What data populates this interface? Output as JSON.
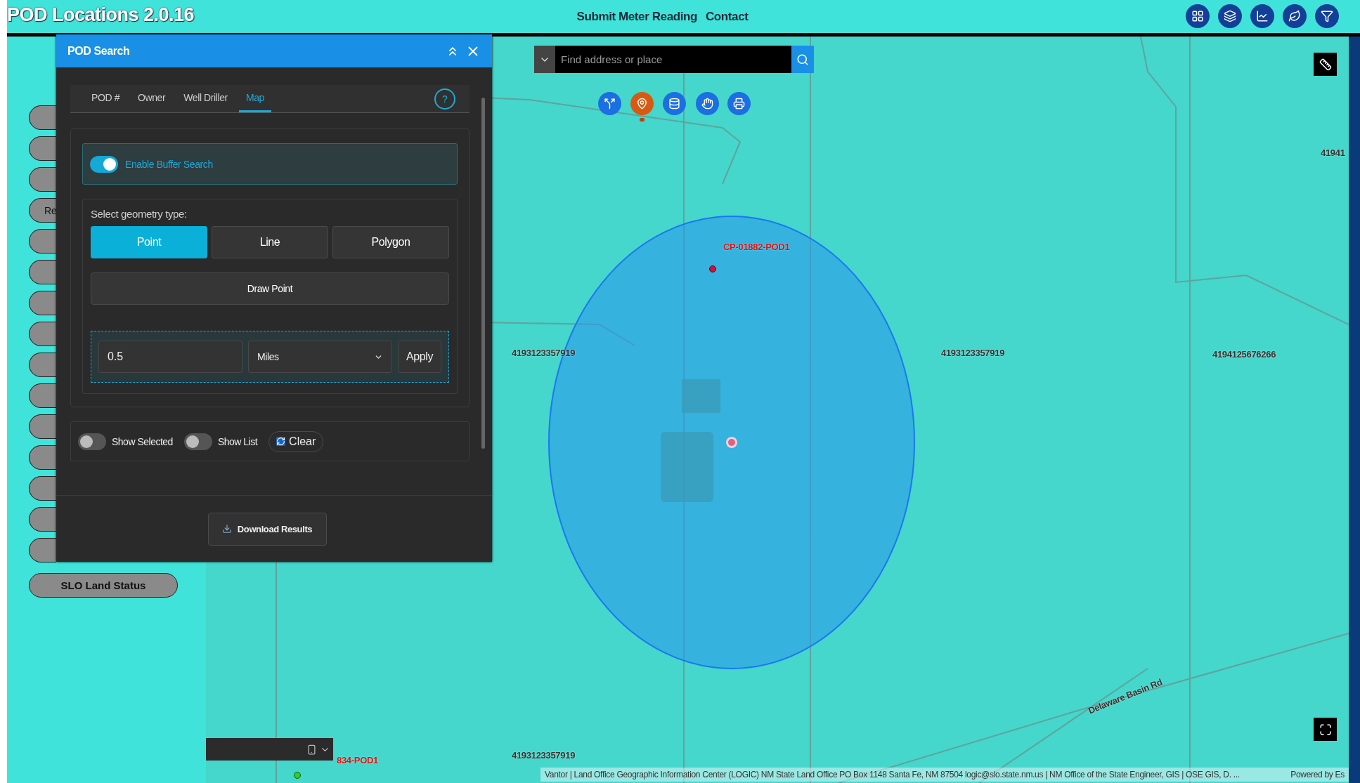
{
  "app": {
    "title": "POD Locations 2.0.16",
    "nav_links": [
      "Submit Meter Reading",
      "Contact"
    ]
  },
  "sidebar": {
    "pills": [
      {
        "kind": "blank"
      },
      {
        "kind": "blank"
      },
      {
        "kind": "blank"
      },
      {
        "kind": "text",
        "label": "Re"
      },
      {
        "kind": "blank"
      },
      {
        "kind": "blank"
      },
      {
        "kind": "blank"
      },
      {
        "kind": "blank"
      },
      {
        "kind": "blank"
      },
      {
        "kind": "blank"
      },
      {
        "kind": "blank"
      },
      {
        "kind": "blank"
      },
      {
        "kind": "blank"
      },
      {
        "kind": "blank"
      },
      {
        "kind": "blank"
      },
      {
        "kind": "text",
        "label": "SLO Land Status"
      }
    ]
  },
  "panel": {
    "title": "POD Search",
    "tabs": [
      {
        "label": "POD #",
        "selected": false
      },
      {
        "label": "Owner",
        "selected": false
      },
      {
        "label": "Well Driller",
        "selected": false
      },
      {
        "label": "Map",
        "selected": true
      }
    ],
    "help": "?",
    "buffer": {
      "label": "Enable Buffer Search",
      "on": true
    },
    "geometry": {
      "label": "Select geometry type:",
      "types": [
        {
          "label": "Point",
          "selected": true
        },
        {
          "label": "Line",
          "selected": false
        },
        {
          "label": "Polygon",
          "selected": false
        }
      ],
      "draw_button": "Draw Point"
    },
    "distance": {
      "value": "0.5",
      "unit": "Miles",
      "apply": "Apply"
    },
    "toggles": [
      {
        "label": "Show Selected",
        "on": false
      },
      {
        "label": "Show List",
        "on": false
      }
    ],
    "clear_button": "Clear",
    "download_button": "Download Results"
  },
  "map": {
    "search": {
      "placeholder": "Find address or place"
    },
    "tools": [
      {
        "selected": false
      },
      {
        "selected": true
      },
      {
        "selected": false
      },
      {
        "selected": false
      },
      {
        "selected": false
      }
    ],
    "labels": [
      {
        "kind": "pod",
        "text": "CP-01882-POD1"
      },
      {
        "kind": "parcel",
        "text": "4193123357919"
      },
      {
        "kind": "parcel",
        "text": "4193123357919"
      },
      {
        "kind": "parcel",
        "text": "4194125676266"
      },
      {
        "kind": "parcel",
        "text": "41941"
      },
      {
        "kind": "parcel",
        "text": "4193123357919"
      },
      {
        "kind": "pod",
        "text": "834-POD1"
      },
      {
        "kind": "road",
        "text": "Delaware Basin Rd"
      }
    ],
    "attribution": "Vantor | Land Office Geographic Information Center (LOGIC) NM State Land Office PO Box 1148 Santa Fe, NM 87504 logic@slo.state.nm.us | NM Office of the State Engineer, GIS | OSE GIS, D. ...",
    "powered_by": "Powered by Es"
  }
}
